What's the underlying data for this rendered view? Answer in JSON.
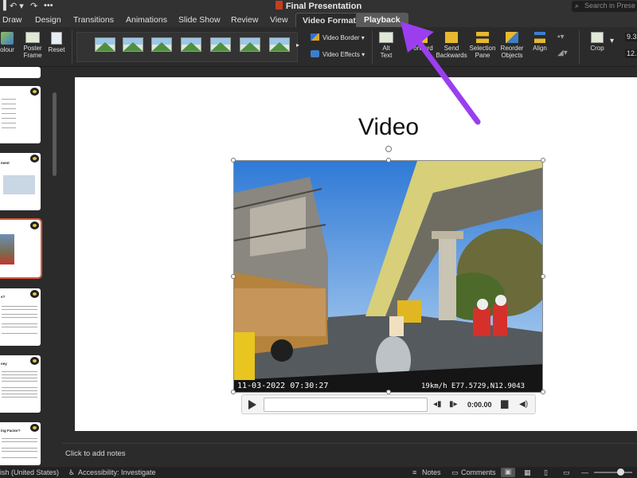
{
  "app": {
    "title": "Final Presentation"
  },
  "quick_access": {
    "undo_icon": "undo-icon",
    "redo_icon": "redo-icon"
  },
  "search": {
    "placeholder": "Search in Prese"
  },
  "tabs": [
    {
      "label": "Draw"
    },
    {
      "label": "Design"
    },
    {
      "label": "Transitions"
    },
    {
      "label": "Animations"
    },
    {
      "label": "Slide Show"
    },
    {
      "label": "Review"
    },
    {
      "label": "View"
    },
    {
      "label": "Video Format",
      "active": true
    },
    {
      "label": "Playback"
    }
  ],
  "ribbon": {
    "colour_label": "olour",
    "poster_label_1": "Poster",
    "poster_label_2": "Frame",
    "reset_label": "Reset",
    "video_border_label": "Video Border",
    "video_effects_label": "Video Effects",
    "alt_text_label_1": "Alt",
    "alt_text_label_2": "Text",
    "forward_label": "Forward",
    "send_backward_label_1": "Send",
    "send_backward_label_2": "Backwards",
    "selection_pane_label_1": "Selection",
    "selection_pane_label_2": "Pane",
    "reorder_label_1": "Reorder",
    "reorder_label_2": "Objects",
    "align_label": "Align",
    "crop_label": "Crop",
    "height_value": "9.3",
    "width_value": "12."
  },
  "thumbnails": [
    {
      "text": ""
    },
    {
      "text": "ment"
    },
    {
      "text": ""
    },
    {
      "text": "s?"
    },
    {
      "text": "ney"
    },
    {
      "text": "ing Factor?"
    }
  ],
  "slide": {
    "title": "Video",
    "video_overlay_date": "11-03-2022 07:30:27",
    "video_overlay_gps": "19km/h E77.5729,N12.9043"
  },
  "player": {
    "time": "0:00.00"
  },
  "notes": {
    "placeholder": "Click to add notes"
  },
  "status": {
    "language": "ish (United States)",
    "accessibility": "Accessibility: Investigate",
    "notes_label": "Notes",
    "comments_label": "Comments"
  },
  "colors": {
    "accent_arrow": "#9b3ef0",
    "selected_thumb": "#e0573b",
    "ppt_badge": "#c43e1c"
  }
}
